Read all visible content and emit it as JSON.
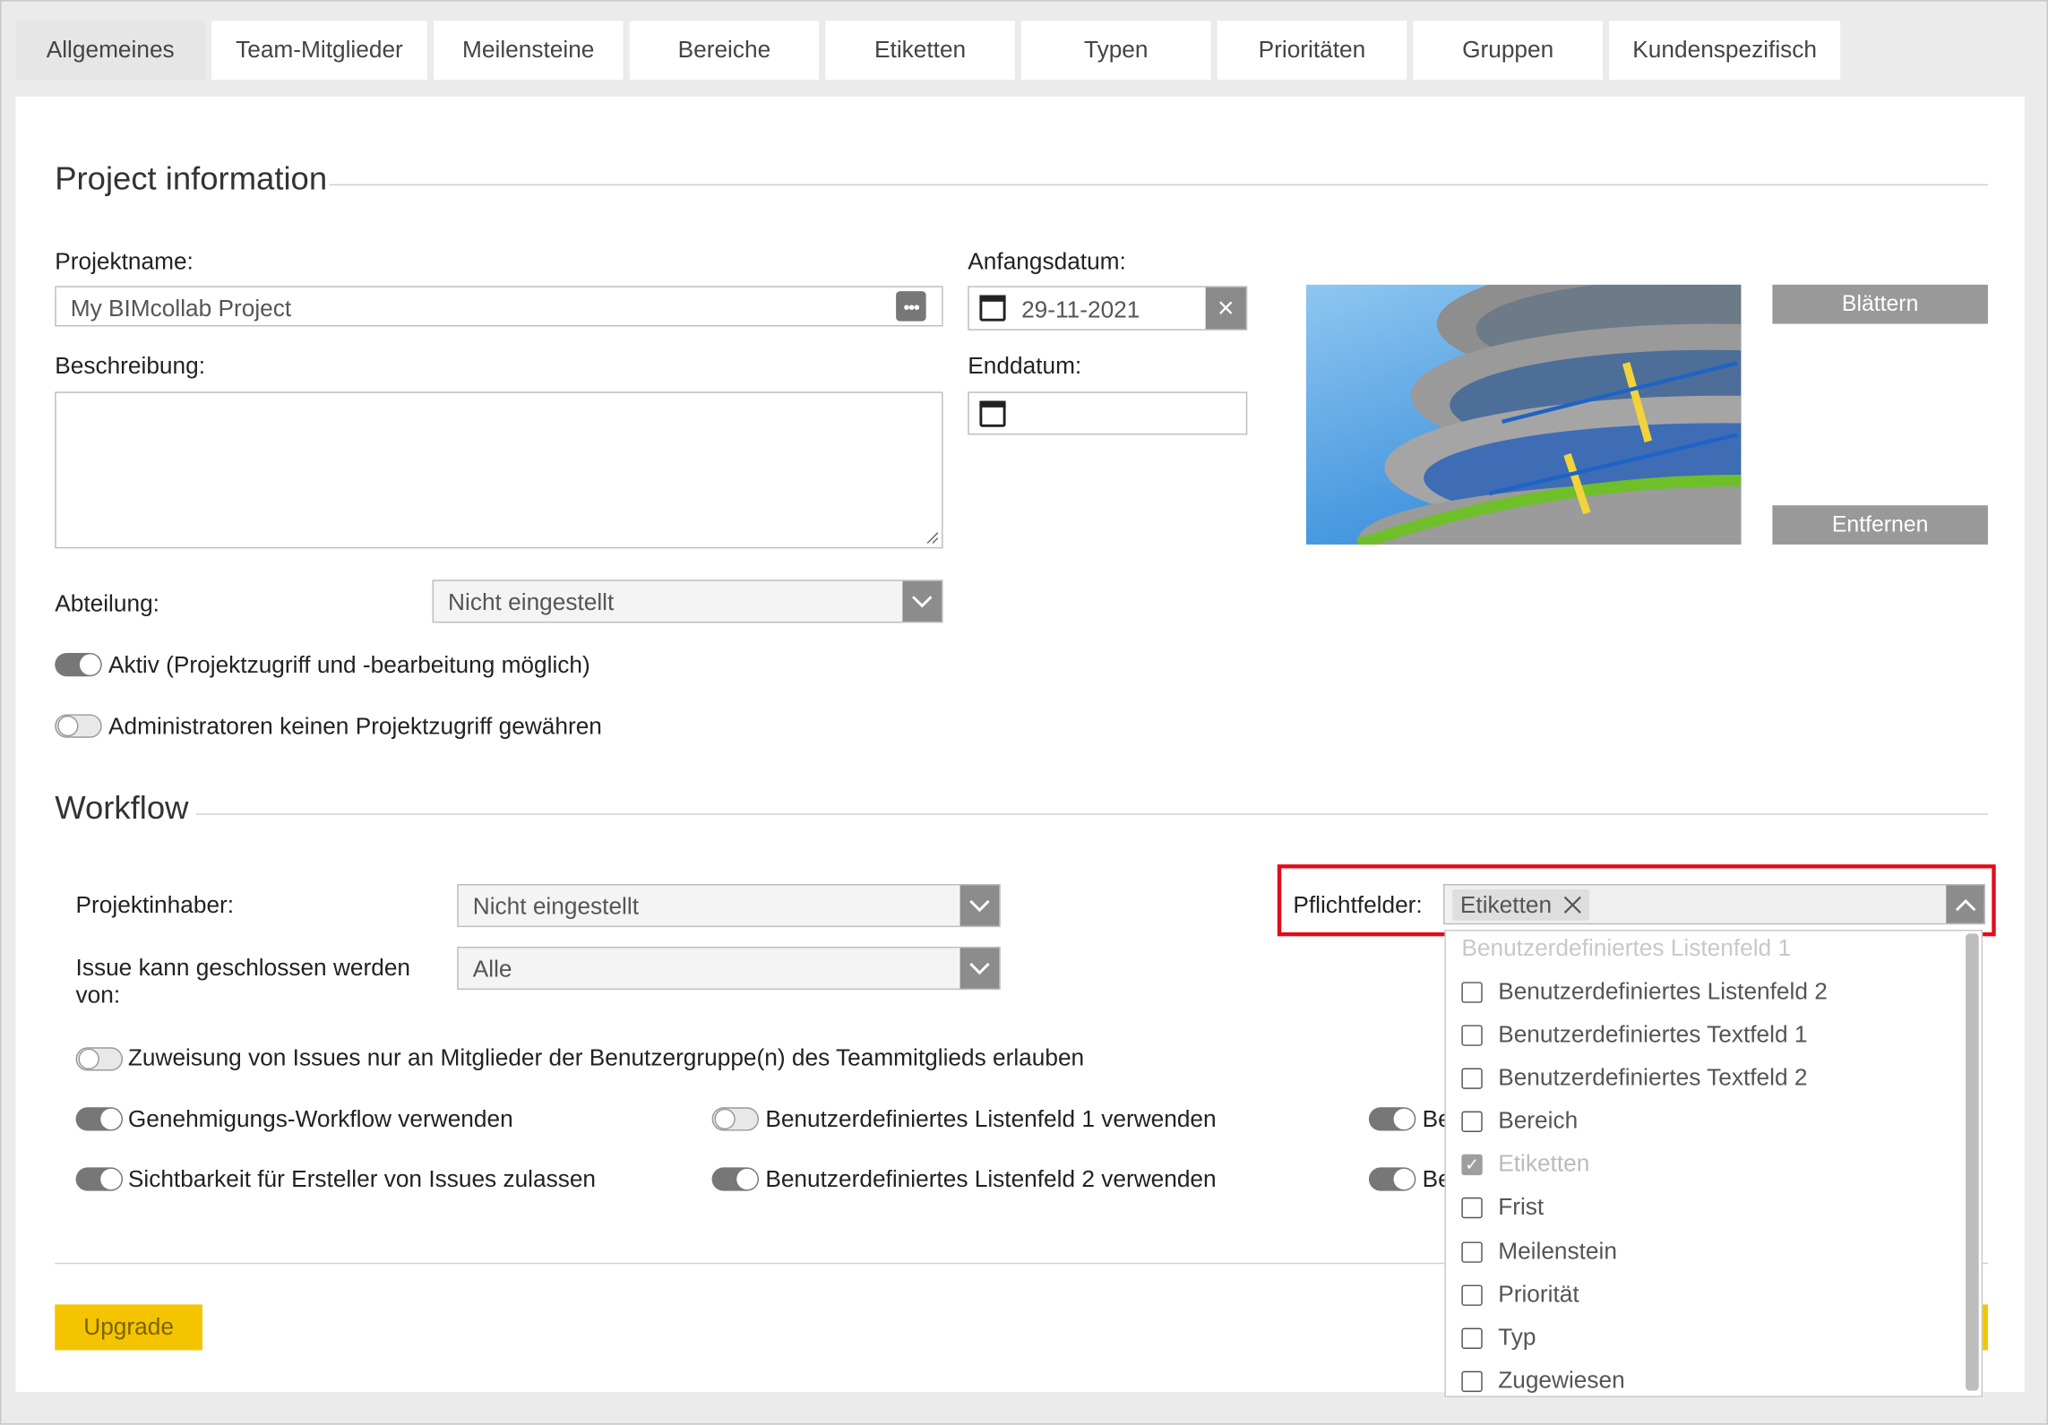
{
  "tabs": [
    {
      "label": "Allgemeines",
      "active": true
    },
    {
      "label": "Team-Mitglieder"
    },
    {
      "label": "Meilensteine"
    },
    {
      "label": "Bereiche"
    },
    {
      "label": "Etiketten"
    },
    {
      "label": "Typen"
    },
    {
      "label": "Prioritäten"
    },
    {
      "label": "Gruppen"
    },
    {
      "label": "Kundenspezifisch"
    }
  ],
  "project_info": {
    "title": "Project information",
    "name_label": "Projektname:",
    "name_value": "My BIMcollab Project",
    "description_label": "Beschreibung:",
    "description_value": "",
    "start_label": "Anfangsdatum:",
    "start_value": "29-11-2021",
    "end_label": "Enddatum:",
    "end_value": "",
    "browse_button": "Blättern",
    "remove_button": "Entfernen",
    "department_label": "Abteilung:",
    "department_value": "Nicht eingestellt",
    "active_label": "Aktiv (Projektzugriff und -bearbeitung möglich)",
    "active_on": true,
    "admin_label": "Administratoren keinen Projektzugriff gewähren",
    "admin_on": false
  },
  "workflow": {
    "title": "Workflow",
    "owner_label": "Projektinhaber:",
    "owner_value": "Nicht eingestellt",
    "close_label_1": "Issue kann geschlossen werden",
    "close_label_2": "von:",
    "close_value": "Alle",
    "assign_toggle": "Zuweisung von Issues nur an Mitglieder der Benutzergruppe(n) des Teammitglieds erlauben",
    "approval_toggle": "Genehmigungs-Workflow verwenden",
    "visibility_toggle": "Sichtbarkeit für Ersteller von Issues zulassen",
    "list1_toggle": "Benutzerdefiniertes Listenfeld 1 verwenden",
    "list2_toggle": "Benutzerdefiniertes Listenfeld 2 verwenden",
    "cut_text_1": "Be",
    "cut_text_2": "Be",
    "required_label": "Pflichtfelder:",
    "required_tag": "Etiketten",
    "upgrade_button": "Upgrade"
  },
  "dropdown": {
    "partial_item": "Benutzerdefiniertes Listenfeld 1",
    "items": [
      {
        "label": "Benutzerdefiniertes Listenfeld 2",
        "checked": false
      },
      {
        "label": "Benutzerdefiniertes Textfeld 1",
        "checked": false
      },
      {
        "label": "Benutzerdefiniertes Textfeld 2",
        "checked": false
      },
      {
        "label": "Bereich",
        "checked": false
      },
      {
        "label": "Etiketten",
        "checked": true
      },
      {
        "label": "Frist",
        "checked": false
      },
      {
        "label": "Meilenstein",
        "checked": false
      },
      {
        "label": "Priorität",
        "checked": false
      },
      {
        "label": "Typ",
        "checked": false
      },
      {
        "label": "Zugewiesen",
        "checked": false
      }
    ]
  },
  "colors": {
    "highlight": "#e20c19",
    "upgrade": "#f5c400",
    "toggle_on": "#777777"
  }
}
